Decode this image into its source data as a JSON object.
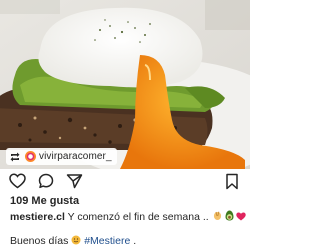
{
  "post": {
    "image_description_icon": "avocado-toast-photo",
    "repost": {
      "icon": "repost-icon",
      "username": "vivirparacomer_"
    },
    "actions": {
      "like_icon": "heart-outline-icon",
      "comment_icon": "comment-bubble-icon",
      "share_icon": "paper-plane-icon",
      "save_icon": "bookmark-icon"
    },
    "likes": "109 Me gusta",
    "caption": {
      "username": "mestiere.cl",
      "text": " Y comenzó el fin de semana .. "
    },
    "caption_line2": {
      "text": "Buenos días ",
      "hashtag": "#Mestiere",
      "tail": " ."
    },
    "colors": {
      "text": "#262626",
      "hashtag": "#1f4e8c",
      "yolk": "#f39a1a"
    }
  }
}
